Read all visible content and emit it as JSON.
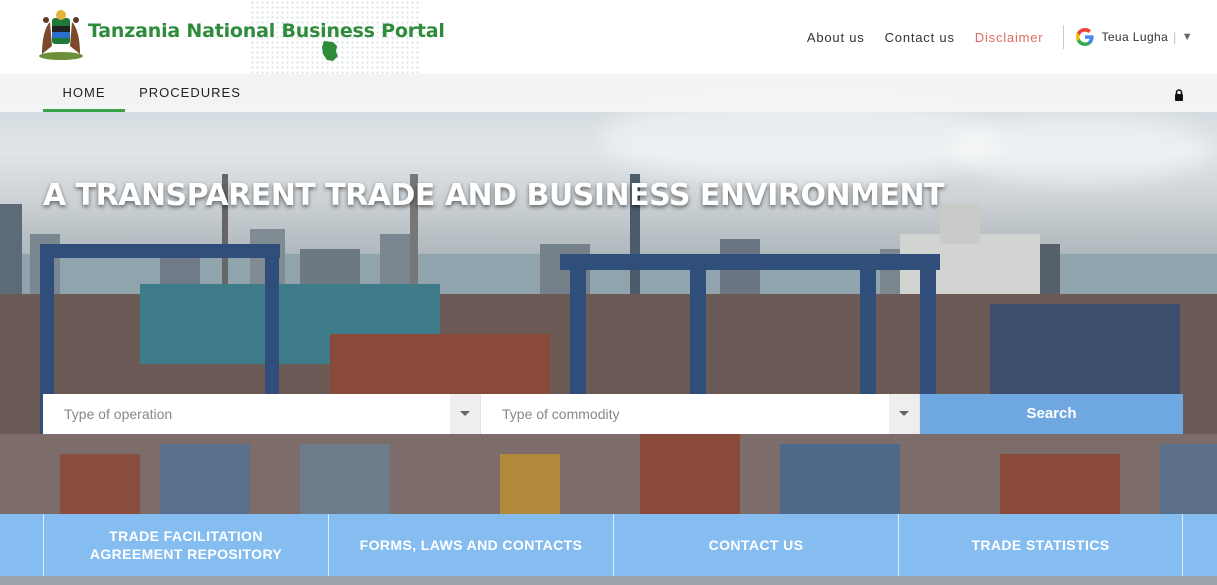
{
  "header": {
    "site_title": "Tanzania National Business Portal",
    "links": [
      "About us",
      "Contact us",
      "Disclaimer"
    ],
    "language_label": "Teua Lugha"
  },
  "nav": {
    "items": [
      "HOME",
      "PROCEDURES"
    ]
  },
  "hero": {
    "title": "A TRANSPARENT TRADE AND BUSINESS ENVIRONMENT",
    "search": {
      "operation_placeholder": "Type of operation",
      "commodity_placeholder": "Type of commodity",
      "button_label": "Search"
    }
  },
  "tiles": [
    {
      "line1": "TRADE FACILITATION",
      "line2": "AGREEMENT REPOSITORY"
    },
    {
      "line1": "FORMS, LAWS AND CONTACTS",
      "line2": ""
    },
    {
      "line1": "CONTACT US",
      "line2": ""
    },
    {
      "line1": "TRADE STATISTICS",
      "line2": ""
    }
  ],
  "colors": {
    "brand_green": "#2e8b3a",
    "nav_active": "#3aa24a",
    "disclaimer": "#e06a5f",
    "search_button": "#6fa8e0",
    "tile_bar": "#86bdf0"
  }
}
